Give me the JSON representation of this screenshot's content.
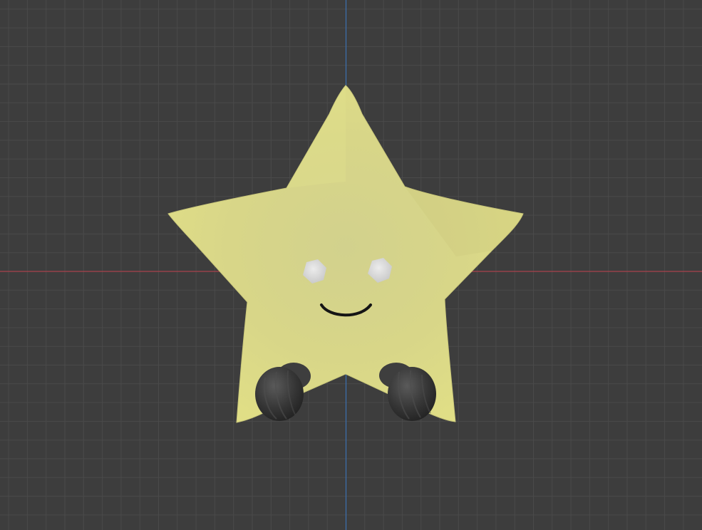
{
  "viewport": {
    "background_color": "#3d3d3d",
    "grid_minor_color": "#4a4a4a",
    "grid_major_color": "#525252",
    "axis_x_color": "#a8424c",
    "axis_y_color": "#3b6fb0"
  },
  "model": {
    "subject": "star-character",
    "body_color": "#d8d688",
    "body_shade_color": "#bfbd70",
    "eye_color": "#d9d9d9",
    "mouth_color": "#151515",
    "feet_color": "#3a3a3a",
    "feet_highlight_color": "#5a5a5a"
  }
}
